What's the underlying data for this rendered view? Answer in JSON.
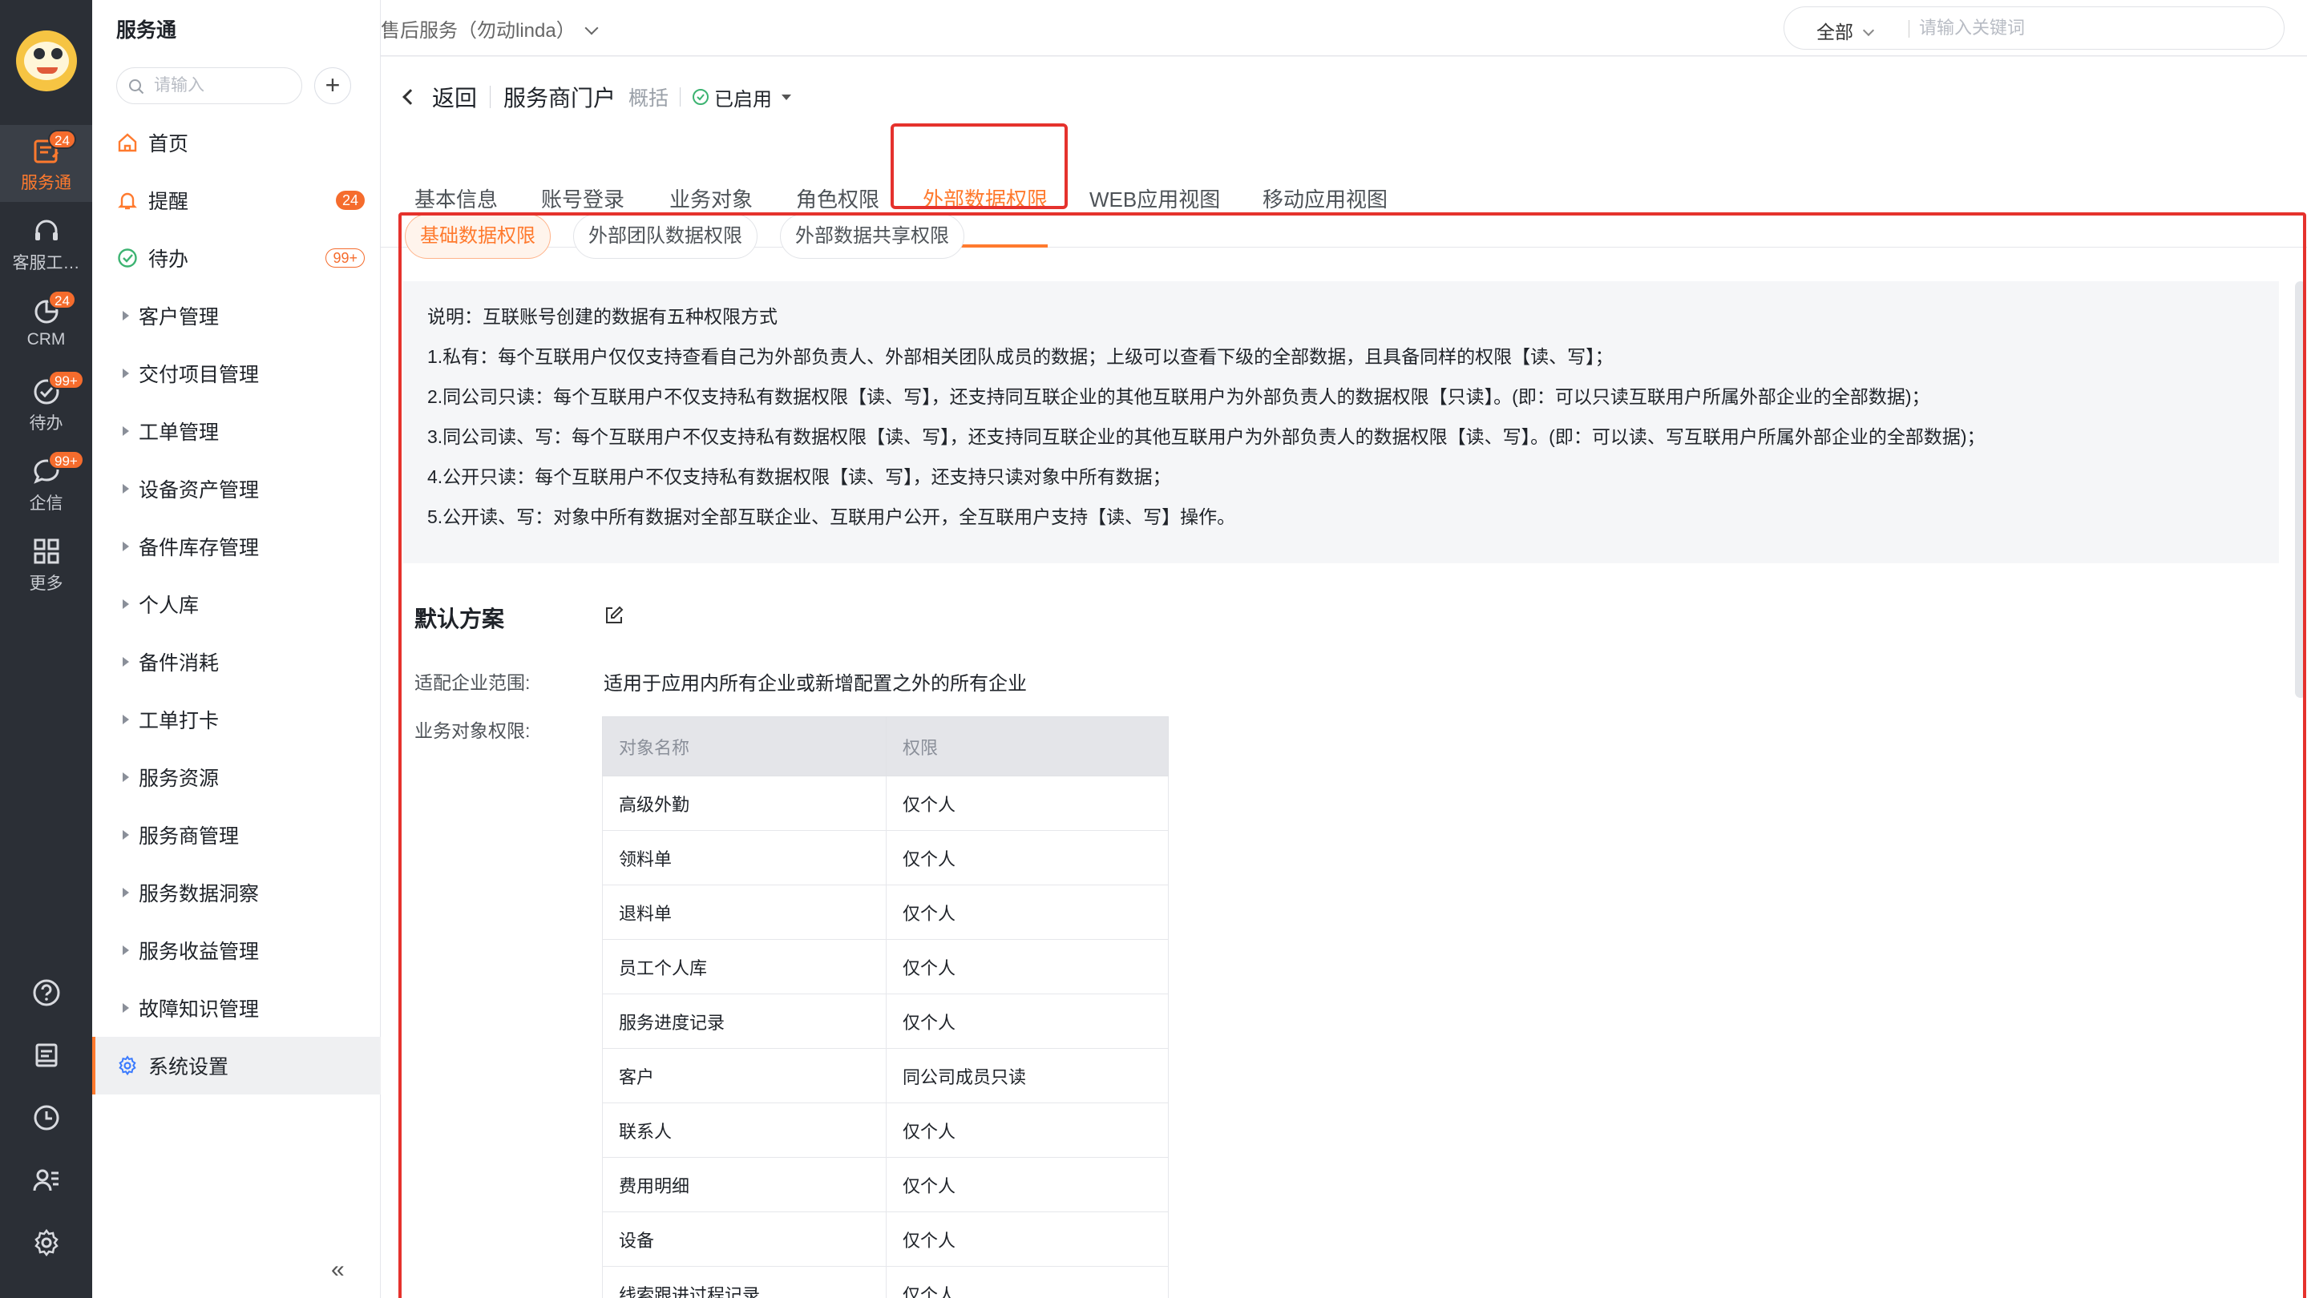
{
  "rail": {
    "items": [
      {
        "label": "服务通",
        "badge": "24"
      },
      {
        "label": "客服工…",
        "badge": ""
      },
      {
        "label": "CRM",
        "badge": "24"
      },
      {
        "label": "待办",
        "badge": "99+"
      },
      {
        "label": "企信",
        "badge": "99+"
      },
      {
        "label": "更多",
        "badge": ""
      }
    ]
  },
  "sidebar": {
    "brand": "服务通",
    "search_placeholder": "请输入",
    "add_label": "+",
    "items": [
      {
        "label": "首页",
        "icon": "home-icon"
      },
      {
        "label": "提醒",
        "icon": "bell-icon",
        "count": "24"
      },
      {
        "label": "待办",
        "icon": "check-circle-icon",
        "count": "99+"
      },
      {
        "label": "客户管理"
      },
      {
        "label": "交付项目管理"
      },
      {
        "label": "工单管理"
      },
      {
        "label": "设备资产管理"
      },
      {
        "label": "备件库存管理"
      },
      {
        "label": "个人库"
      },
      {
        "label": "备件消耗"
      },
      {
        "label": "工单打卡"
      },
      {
        "label": "服务资源"
      },
      {
        "label": "服务商管理"
      },
      {
        "label": "服务数据洞察"
      },
      {
        "label": "服务收益管理"
      },
      {
        "label": "故障知识管理"
      },
      {
        "label": "系统设置",
        "icon": "gear-icon",
        "active": true
      }
    ],
    "collapse_label": "«"
  },
  "topbar": {
    "section": "售后服务（勿动linda）",
    "scope": "全部",
    "search_placeholder": "请输入关键词"
  },
  "breadcrumb": {
    "back": "返回",
    "name": "服务商门户",
    "overview": "概括",
    "status": "已启用"
  },
  "tabs": [
    "基本信息",
    "账号登录",
    "业务对象",
    "角色权限",
    "外部数据权限",
    "WEB应用视图",
    "移动应用视图"
  ],
  "subtabs": [
    "基础数据权限",
    "外部团队数据权限",
    "外部数据共享权限"
  ],
  "description": [
    "说明：互联账号创建的数据有五种权限方式",
    "1.私有：每个互联用户仅仅支持查看自己为外部负责人、外部相关团队成员的数据；上级可以查看下级的全部数据，且具备同样的权限【读、写】；",
    "2.同公司只读：每个互联用户不仅支持私有数据权限【读、写】，还支持同互联企业的其他互联用户为外部负责人的数据权限【只读】。(即：可以只读互联用户所属外部企业的全部数据)；",
    "3.同公司读、写：每个互联用户不仅支持私有数据权限【读、写】，还支持同互联企业的其他互联用户为外部负责人的数据权限【读、写】。(即：可以读、写互联用户所属外部企业的全部数据)；",
    "4.公开只读：每个互联用户不仅支持私有数据权限【读、写】，还支持只读对象中所有数据；",
    "5.公开读、写：对象中所有数据对全部互联企业、互联用户公开，全互联用户支持【读、写】操作。"
  ],
  "plan": {
    "title": "默认方案",
    "scope_label": "适配企业范围:",
    "scope_value": "适用于应用内所有企业或新增配置之外的所有企业",
    "perm_label": "业务对象权限:",
    "table_headers": [
      "对象名称",
      "权限"
    ],
    "rows": [
      [
        "高级外勤",
        "仅个人"
      ],
      [
        "领料单",
        "仅个人"
      ],
      [
        "退料单",
        "仅个人"
      ],
      [
        "员工个人库",
        "仅个人"
      ],
      [
        "服务进度记录",
        "仅个人"
      ],
      [
        "客户",
        "同公司成员只读"
      ],
      [
        "联系人",
        "仅个人"
      ],
      [
        "费用明细",
        "仅个人"
      ],
      [
        "设备",
        "仅个人"
      ],
      [
        "线索跟进过程记录",
        "仅个人"
      ]
    ]
  },
  "colors": {
    "accent": "#ff7a2e",
    "highlight": "#e5322d",
    "rail": "#2b2f36"
  }
}
